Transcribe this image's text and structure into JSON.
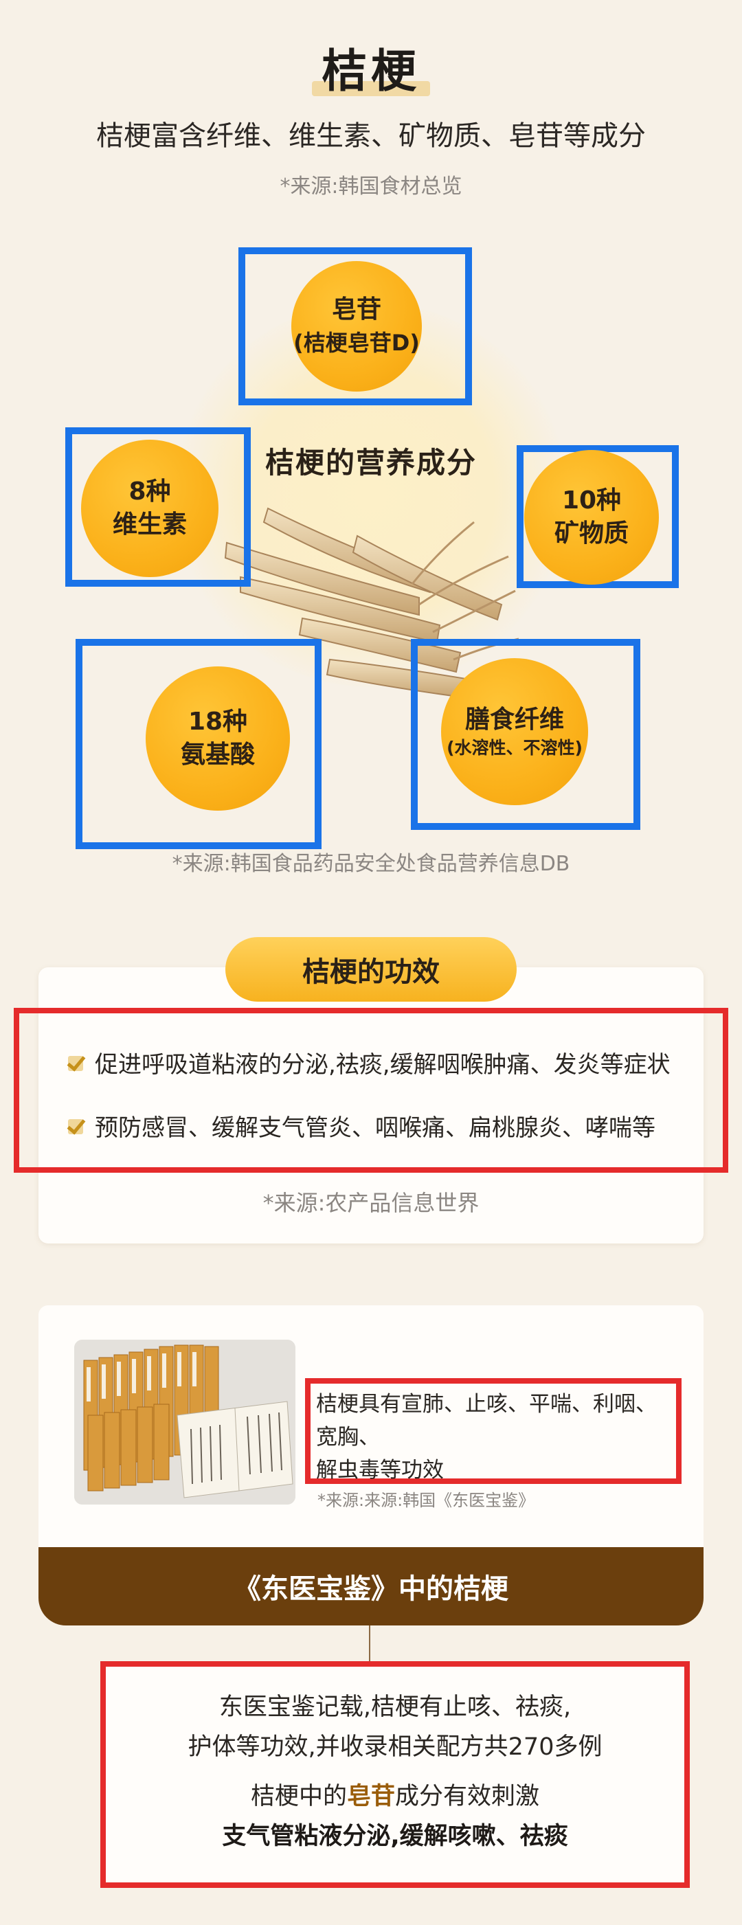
{
  "header": {
    "title": "桔梗",
    "subtitle": "桔梗富含纤维、维生素、矿物质、皂苷等成分",
    "source": "*来源:韩国食材总览"
  },
  "nutrition": {
    "title": "桔梗的营养成分",
    "items": [
      {
        "line1": "皂苷",
        "line2": "(桔梗皂苷D)"
      },
      {
        "line1": "8种",
        "line2": "维生素"
      },
      {
        "line1": "10种",
        "line2": "矿物质"
      },
      {
        "line1": "18种",
        "line2": "氨基酸"
      },
      {
        "line1": "膳食纤维",
        "line2": "(水溶性、不溶性)"
      }
    ],
    "source": "*来源:韩国食品药品安全处食品营养信息DB"
  },
  "effects": {
    "title": "桔梗的功效",
    "items": [
      "促进呼吸道粘液的分泌,祛痰,缓解咽喉肿痛、发炎等症状",
      "预防感冒、缓解支气管炎、咽喉痛、扁桃腺炎、哮喘等"
    ],
    "source": "*来源:农产品信息世界"
  },
  "dongui": {
    "text_line1": "桔梗具有宣肺、止咳、平喘、利咽、宽胸、",
    "text_line2": "解虫毒等功效",
    "source": "*来源:来源:韩国《东医宝鉴》",
    "bar_label": "《东医宝鉴》中的桔梗",
    "para1_line1": "东医宝鉴记载,桔梗有止咳、祛痰,",
    "para1_line2": "护体等功效,并收录相关配方共270多例",
    "para2_pre": "桔梗中的",
    "para2_highlight": "皂苷",
    "para2_post": "成分有效刺激",
    "para3": "支气管粘液分泌,缓解咳嗽、祛痰"
  },
  "colors": {
    "circle": "#fbb11a",
    "blue_box": "#1a73e8",
    "red_box": "#e52b2b",
    "brown_bar": "#6b3f0d",
    "background": "#f7f1e7"
  }
}
